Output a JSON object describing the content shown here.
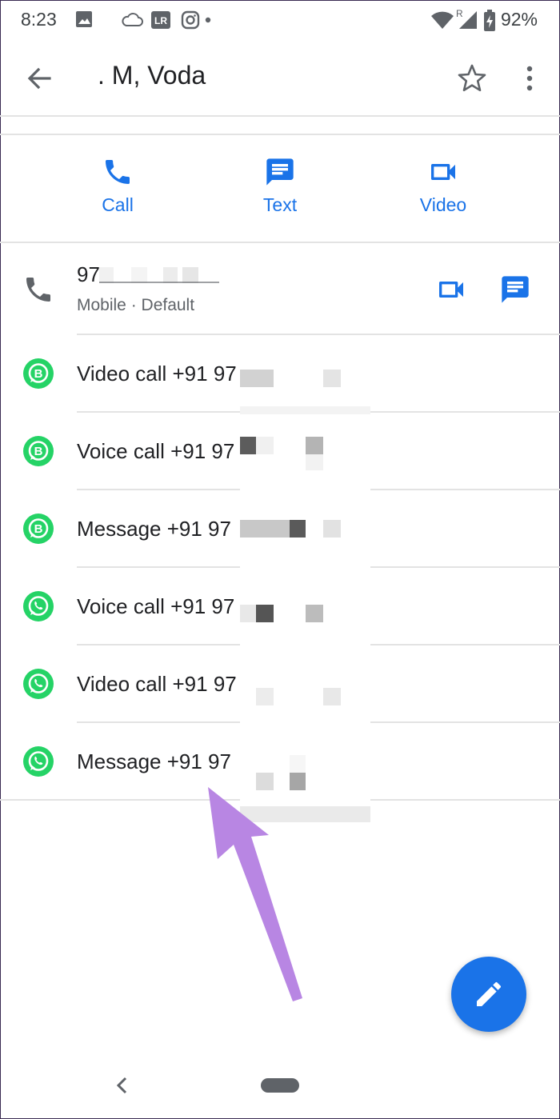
{
  "status_bar": {
    "time": "8:23",
    "icons": [
      "image-icon",
      "cloud-icon",
      "lightroom-icon",
      "instagram-icon",
      "notification-dot",
      "wifi-icon",
      "roaming-signal-icon",
      "battery-charging-icon"
    ],
    "roaming": "R",
    "lightroom_text": "LR",
    "battery": "92%"
  },
  "toolbar": {
    "title": ". M, Voda"
  },
  "actions": {
    "call_label": "Call",
    "text_label": "Text",
    "video_label": "Video"
  },
  "phone_entry": {
    "number": "97",
    "type": "Mobile · Default"
  },
  "app_entries": [
    {
      "app": "whatsapp-business",
      "label": "Video call +91 97"
    },
    {
      "app": "whatsapp-business",
      "label": "Voice call +91 97"
    },
    {
      "app": "whatsapp-business",
      "label": "Message +91 97"
    },
    {
      "app": "whatsapp",
      "label": "Voice call +91 97"
    },
    {
      "app": "whatsapp",
      "label": "Video call +91 97"
    },
    {
      "app": "whatsapp",
      "label": "Message +91 97"
    }
  ],
  "colors": {
    "accent": "#1a73e8",
    "whatsapp_green": "#25d366",
    "annotation_arrow": "#b886e3"
  }
}
